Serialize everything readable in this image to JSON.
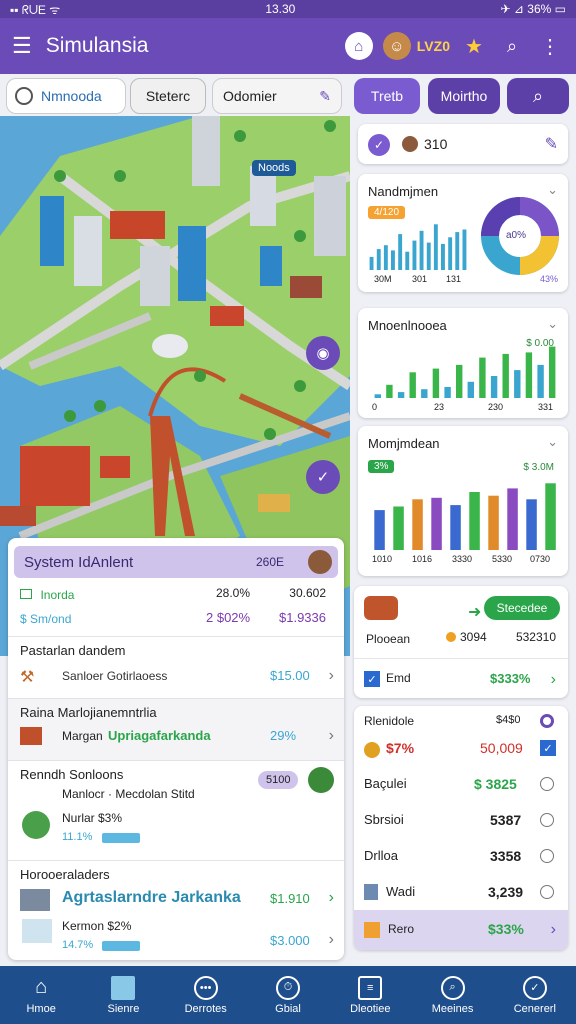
{
  "status": {
    "left": "▪▪ ᖇᑌE ᯤ",
    "time": "13.30",
    "right": "✈ ⊿ 36% ▭"
  },
  "app": {
    "title": "Simulansia",
    "badge": "LVZ0"
  },
  "filters": {
    "search_value": "Nmnooda",
    "tab1": "Steterc",
    "tab2": "Odomier",
    "btn1": "Tretb",
    "btn2": "Moirtho"
  },
  "map": {
    "label": "Noods"
  },
  "summary": {
    "count": "310"
  },
  "charts": [
    {
      "title": "Nandmjmen",
      "badge": "4/120",
      "ticks": [
        "30M",
        "301",
        "131"
      ],
      "donut_label": "a0%",
      "donut_pct": "43%"
    },
    {
      "title": "Mnoenlnooea",
      "value": "$ 0.00",
      "ticks": [
        "0",
        "23",
        "230",
        "331"
      ]
    },
    {
      "title": "Momjmdean",
      "badge": "3%",
      "value": "$ 3.0M",
      "ticks": [
        "1010",
        "1016",
        "3330",
        "5330",
        "0730"
      ]
    }
  ],
  "chart_data": [
    {
      "type": "bar",
      "values": [
        20,
        32,
        38,
        30,
        55,
        28,
        45,
        60,
        42,
        70,
        40,
        50,
        58,
        62
      ]
    },
    {
      "type": "bar",
      "values": [
        5,
        18,
        8,
        35,
        12,
        40,
        15,
        45,
        22,
        55,
        30,
        60,
        38,
        62,
        45,
        70
      ]
    },
    {
      "type": "bar",
      "series": [
        {
          "name": "",
          "values": [
            55,
            60,
            70,
            72,
            62,
            80,
            75,
            85,
            70,
            92
          ]
        }
      ]
    }
  ],
  "action_card": {
    "button": "Stecedee",
    "label": "Plooean",
    "val1": "3094",
    "val2": "532310",
    "check_label": "Emd",
    "check_value": "$333%"
  },
  "list_card": {
    "header": "Rlenidole",
    "header_value": "$4$0",
    "rows": [
      {
        "label": "$7%",
        "value": "50,009",
        "state": "checked",
        "color": "#d0302a"
      },
      {
        "label": "Baçulei",
        "value": "$ 3825",
        "state": "off",
        "color": "#222"
      },
      {
        "label": "Sbrsioi",
        "value": "5387",
        "state": "off",
        "color": "#222"
      },
      {
        "label": "Drlloa",
        "value": "3358",
        "state": "off",
        "color": "#222"
      },
      {
        "label": "Wadi",
        "value": "3,239",
        "state": "off",
        "color": "#222"
      }
    ],
    "footer_label": "Rero",
    "footer_value": "$33%"
  },
  "panel": {
    "header": "System IdAnlent",
    "header_value": "260E",
    "stat1_label": "Inorda",
    "stat1_v1": "28.0%",
    "stat1_v2": "30.602",
    "stat2_label": "$ Sm/ond",
    "stat2_v1": "2 $02%",
    "stat2_v2": "$1.9336",
    "sec1_title": "Pastarlan dandem",
    "sec1_row": "Sanloer Gotirlaoess",
    "sec1_value": "$15.00",
    "sec2_title": "Raina Marlojianemntrlia",
    "sec2_row": "Margan",
    "sec2_link": "Upriagafarkanda",
    "sec2_pct": "29%",
    "sec3_title": "Renndh Sonloons",
    "sec3_badge": "5100",
    "sec3_row": "Manlocr · Mecdolan Stitd",
    "sec3_sub": "Nurlar $3%",
    "sec3_pct": "11.1%",
    "sec4_title": "Horooeraladers",
    "sec4_name": "Agrtaslarndre Jarkanka",
    "sec4_value": "$1.910",
    "sec4_sub": "Kermon $2%",
    "sec4_pct": "14.7%",
    "sec4_v2": "$3.000"
  },
  "nav": [
    "Hmoe",
    "Sienre",
    "Derrotes",
    "Gbial",
    "Dleotiee",
    "Meeines",
    "Cenererl"
  ]
}
